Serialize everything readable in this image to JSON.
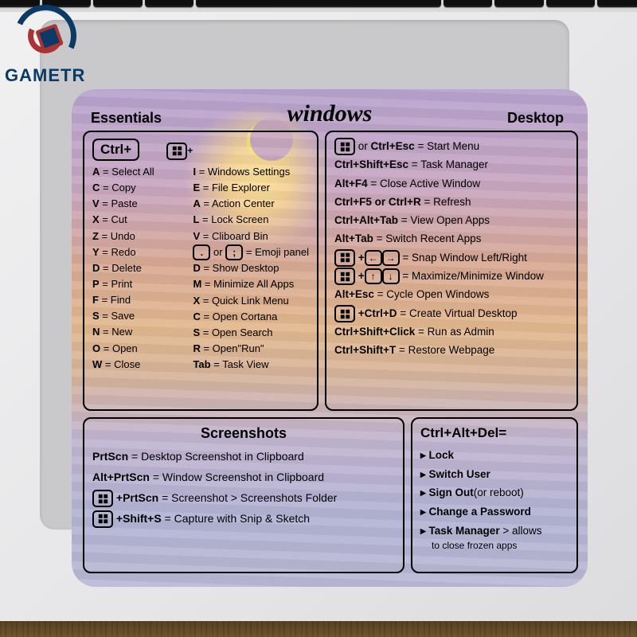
{
  "brand": "GAMETR",
  "title": "windows",
  "headings": {
    "essentials": "Essentials",
    "desktop": "Desktop",
    "screenshots": "Screenshots",
    "ctrlaltdel": "Ctrl+Alt+Del="
  },
  "ctrl_label": "Ctrl+",
  "win_plus_suffix": "+",
  "essentials": {
    "ctrl": [
      {
        "k": "A",
        "d": "Select All"
      },
      {
        "k": "C",
        "d": "Copy"
      },
      {
        "k": "V",
        "d": "Paste"
      },
      {
        "k": "X",
        "d": "Cut"
      },
      {
        "k": "Z",
        "d": "Undo"
      },
      {
        "k": "Y",
        "d": "Redo"
      },
      {
        "k": "D",
        "d": "Delete"
      },
      {
        "k": "P",
        "d": "Print"
      },
      {
        "k": "F",
        "d": "Find"
      },
      {
        "k": "S",
        "d": "Save"
      },
      {
        "k": "N",
        "d": "New"
      },
      {
        "k": "O",
        "d": "Open"
      },
      {
        "k": "W",
        "d": "Close"
      }
    ],
    "win": [
      {
        "k": "I",
        "d": "Windows Settings"
      },
      {
        "k": "E",
        "d": "File Explorer"
      },
      {
        "k": "A",
        "d": "Action Center"
      },
      {
        "k": "L",
        "d": "Lock Screen"
      },
      {
        "k": "V",
        "d": "Cliboard Bin"
      },
      {
        "k": ". or ;",
        "d": "Emoji panel",
        "boxed": true
      },
      {
        "k": "D",
        "d": "Show Desktop"
      },
      {
        "k": "M",
        "d": "Minimize All Apps"
      },
      {
        "k": "X",
        "d": "Quick Link Menu"
      },
      {
        "k": "C",
        "d": "Open Cortana"
      },
      {
        "k": "S",
        "d": "Open Search"
      },
      {
        "k": "R",
        "d": "Open\"Run\""
      },
      {
        "k": "Tab",
        "d": "Task View"
      }
    ]
  },
  "desktop": [
    {
      "combo": "⊞ or Ctrl+Esc",
      "d": "Start Menu",
      "winicon": true
    },
    {
      "combo": "Ctrl+Shift+Esc",
      "d": "Task Manager"
    },
    {
      "combo": "Alt+F4",
      "d": "Close Active Window"
    },
    {
      "combo": "Ctrl+F5 or Ctrl+R",
      "d": "Refresh"
    },
    {
      "combo": "Ctrl+Alt+Tab",
      "d": "View Open Apps"
    },
    {
      "combo": "Alt+Tab",
      "d": "Switch Recent Apps"
    },
    {
      "combo": "⊞ + ← →",
      "d": "Snap Window Left/Right",
      "winicon": true,
      "arrows": "lr"
    },
    {
      "combo": "⊞ + ↑ ↓",
      "d": "Maximize/Minimize Window",
      "winicon": true,
      "arrows": "ud"
    },
    {
      "combo": "Alt+Esc",
      "d": "Cycle Open Windows"
    },
    {
      "combo": "⊞ +Ctrl+D",
      "d": "Create Virtual Desktop",
      "winicon": true
    },
    {
      "combo": "Ctrl+Shift+Click",
      "d": "Run as Admin"
    },
    {
      "combo": "Ctrl+Shift+T",
      "d": "Restore Webpage"
    }
  ],
  "screenshots": [
    {
      "combo": "PrtScn",
      "d": "Desktop Screenshot in Clipboard"
    },
    {
      "combo": "Alt+PrtScn",
      "d": "Window Screenshot in Clipboard"
    },
    {
      "combo": "⊞ +PrtScn",
      "d": "Screenshot > Screenshots Folder",
      "winicon": true
    },
    {
      "combo": "⊞ +Shift+S",
      "d": "Capture with Snip & Sketch",
      "winicon": true
    }
  ],
  "ctrlaltdel_items": [
    {
      "t": "Lock"
    },
    {
      "t": "Switch User"
    },
    {
      "t": "Sign Out",
      "note": "(or reboot)"
    },
    {
      "t": "Change a Password"
    },
    {
      "t": "Task Manager",
      "note": "> allows to close frozen apps",
      "multiline": true
    }
  ]
}
